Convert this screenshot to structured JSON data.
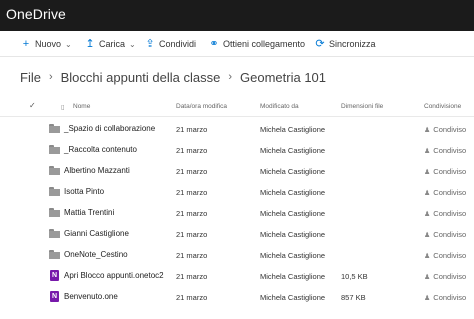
{
  "app": {
    "title": "OneDrive"
  },
  "commands": [
    {
      "icon": "plus-icon",
      "glyph": "+",
      "label": "Nuovo",
      "dropdown": true
    },
    {
      "icon": "upload-icon",
      "glyph": "↥",
      "label": "Carica",
      "dropdown": true
    },
    {
      "icon": "share-icon",
      "glyph": "⇪",
      "label": "Condividi",
      "dropdown": false
    },
    {
      "icon": "link-icon",
      "glyph": "⚭",
      "label": "Ottieni collegamento",
      "dropdown": false
    },
    {
      "icon": "sync-icon",
      "glyph": "⟳",
      "label": "Sincronizza",
      "dropdown": false
    }
  ],
  "breadcrumb": [
    "File",
    "Blocchi appunti della classe",
    "Geometria 101"
  ],
  "columns": {
    "name": "Nome",
    "modified": "Data/ora modifica",
    "modified_by": "Modificato da",
    "size": "Dimensioni file",
    "sharing": "Condivisione"
  },
  "files": [
    {
      "type": "folder",
      "name": "_Spazio di collaborazione",
      "modified": "21 marzo",
      "modified_by": "Michela Castiglione",
      "size": "",
      "sharing": "Condiviso"
    },
    {
      "type": "folder",
      "name": "_Raccolta contenuto",
      "modified": "21 marzo",
      "modified_by": "Michela Castiglione",
      "size": "",
      "sharing": "Condiviso"
    },
    {
      "type": "folder",
      "name": "Albertino Mazzanti",
      "modified": "21 marzo",
      "modified_by": "Michela Castiglione",
      "size": "",
      "sharing": "Condiviso"
    },
    {
      "type": "folder",
      "name": "Isotta Pinto",
      "modified": "21 marzo",
      "modified_by": "Michela Castiglione",
      "size": "",
      "sharing": "Condiviso"
    },
    {
      "type": "folder",
      "name": "Mattia Trentini",
      "modified": "21 marzo",
      "modified_by": "Michela Castiglione",
      "size": "",
      "sharing": "Condiviso"
    },
    {
      "type": "folder",
      "name": "Gianni Castiglione",
      "modified": "21 marzo",
      "modified_by": "Michela Castiglione",
      "size": "",
      "sharing": "Condiviso"
    },
    {
      "type": "folder",
      "name": "OneNote_Cestino",
      "modified": "21 marzo",
      "modified_by": "Michela Castiglione",
      "size": "",
      "sharing": "Condiviso"
    },
    {
      "type": "onenote",
      "name": "Apri Blocco appunti.onetoc2",
      "modified": "21 marzo",
      "modified_by": "Michela Castiglione",
      "size": "10,5 KB",
      "sharing": "Condiviso"
    },
    {
      "type": "onenote",
      "name": "Benvenuto.one",
      "modified": "21 marzo",
      "modified_by": "Michela Castiglione",
      "size": "857 KB",
      "sharing": "Condiviso"
    }
  ]
}
